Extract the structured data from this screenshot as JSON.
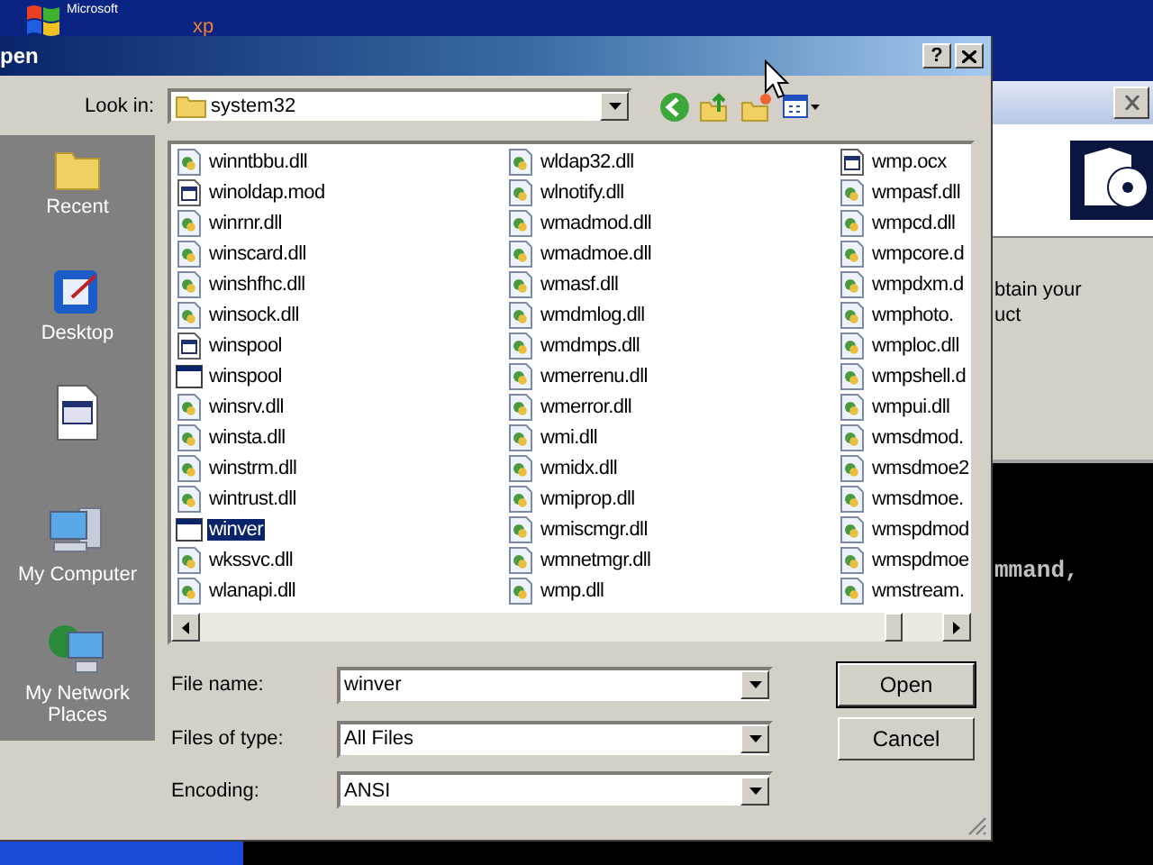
{
  "desktop": {
    "logo_small": "Microsoft",
    "logo_suffix": "xp"
  },
  "background_window": {
    "lines": [
      "btain your",
      "uct"
    ]
  },
  "console": {
    "text": "mmand,"
  },
  "dialog": {
    "title": "pen",
    "help": "?",
    "look_in": {
      "label": "Look in:",
      "value": "system32"
    },
    "places": [
      {
        "label": "Recent",
        "kind": "recent"
      },
      {
        "label": "Desktop",
        "kind": "desktop"
      },
      {
        "kind": "documents"
      },
      {
        "label": "My Computer",
        "kind": "computer"
      },
      {
        "label": "My Network Places",
        "kind": "network"
      }
    ],
    "file_columns": [
      [
        {
          "name": "winntbbu.dll",
          "kind": "dll",
          "selected": false
        },
        {
          "name": "winoldap.mod",
          "kind": "mod",
          "selected": false
        },
        {
          "name": "winrnr.dll",
          "kind": "dll",
          "selected": false
        },
        {
          "name": "winscard.dll",
          "kind": "dll",
          "selected": false
        },
        {
          "name": "winshfhc.dll",
          "kind": "dll",
          "selected": false
        },
        {
          "name": "winsock.dll",
          "kind": "dll",
          "selected": false
        },
        {
          "name": "winspool",
          "kind": "mod",
          "selected": false
        },
        {
          "name": "winspool",
          "kind": "exe",
          "selected": false
        },
        {
          "name": "winsrv.dll",
          "kind": "dll",
          "selected": false
        },
        {
          "name": "winsta.dll",
          "kind": "dll",
          "selected": false
        },
        {
          "name": "winstrm.dll",
          "kind": "dll",
          "selected": false
        },
        {
          "name": "wintrust.dll",
          "kind": "dll",
          "selected": false
        },
        {
          "name": "winver",
          "kind": "exe",
          "selected": true
        },
        {
          "name": "wkssvc.dll",
          "kind": "dll",
          "selected": false
        },
        {
          "name": "wlanapi.dll",
          "kind": "dll",
          "selected": false
        }
      ],
      [
        {
          "name": "wldap32.dll",
          "kind": "dll",
          "selected": false
        },
        {
          "name": "wlnotify.dll",
          "kind": "dll",
          "selected": false
        },
        {
          "name": "wmadmod.dll",
          "kind": "dll",
          "selected": false
        },
        {
          "name": "wmadmoe.dll",
          "kind": "dll",
          "selected": false
        },
        {
          "name": "wmasf.dll",
          "kind": "dll",
          "selected": false
        },
        {
          "name": "wmdmlog.dll",
          "kind": "dll",
          "selected": false
        },
        {
          "name": "wmdmps.dll",
          "kind": "dll",
          "selected": false
        },
        {
          "name": "wmerrenu.dll",
          "kind": "dll",
          "selected": false
        },
        {
          "name": "wmerror.dll",
          "kind": "dll",
          "selected": false
        },
        {
          "name": "wmi.dll",
          "kind": "dll",
          "selected": false
        },
        {
          "name": "wmidx.dll",
          "kind": "dll",
          "selected": false
        },
        {
          "name": "wmiprop.dll",
          "kind": "dll",
          "selected": false
        },
        {
          "name": "wmiscmgr.dll",
          "kind": "dll",
          "selected": false
        },
        {
          "name": "wmnetmgr.dll",
          "kind": "dll",
          "selected": false
        },
        {
          "name": "wmp.dll",
          "kind": "dll",
          "selected": false
        }
      ],
      [
        {
          "name": "wmp.ocx",
          "kind": "mod",
          "selected": false
        },
        {
          "name": "wmpasf.dll",
          "kind": "dll",
          "selected": false
        },
        {
          "name": "wmpcd.dll",
          "kind": "dll",
          "selected": false
        },
        {
          "name": "wmpcore.d",
          "kind": "dll",
          "selected": false
        },
        {
          "name": "wmpdxm.d",
          "kind": "dll",
          "selected": false
        },
        {
          "name": "wmphoto.",
          "kind": "dll",
          "selected": false
        },
        {
          "name": "wmploc.dll",
          "kind": "dll",
          "selected": false
        },
        {
          "name": "wmpshell.d",
          "kind": "dll",
          "selected": false
        },
        {
          "name": "wmpui.dll",
          "kind": "dll",
          "selected": false
        },
        {
          "name": "wmsdmod.",
          "kind": "dll",
          "selected": false
        },
        {
          "name": "wmsdmoe2",
          "kind": "dll",
          "selected": false
        },
        {
          "name": "wmsdmoe.",
          "kind": "dll",
          "selected": false
        },
        {
          "name": "wmspdmod",
          "kind": "dll",
          "selected": false
        },
        {
          "name": "wmspdmoe",
          "kind": "dll",
          "selected": false
        },
        {
          "name": "wmstream.",
          "kind": "dll",
          "selected": false
        }
      ]
    ],
    "fields": [
      {
        "label": "File name:",
        "value": "winver"
      },
      {
        "label": "Files of type:",
        "value": "All Files"
      },
      {
        "label": "Encoding:",
        "value": "ANSI"
      }
    ],
    "buttons": [
      {
        "label": "Open",
        "default": true
      },
      {
        "label": "Cancel",
        "default": false
      }
    ]
  }
}
